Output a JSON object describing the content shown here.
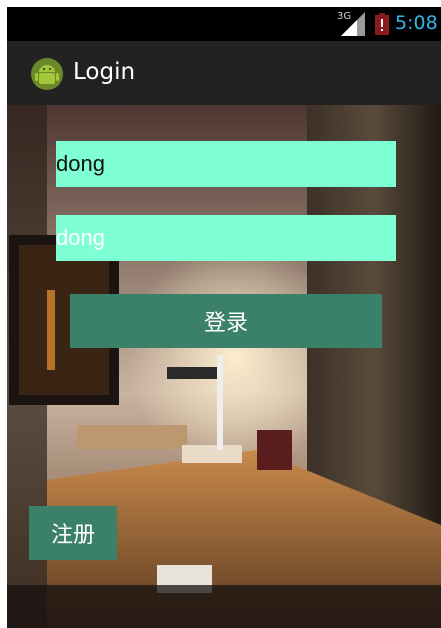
{
  "status_bar": {
    "network": "3G",
    "time": "5:08",
    "signal_icon": "signal-icon",
    "battery_icon": "battery-low-icon"
  },
  "action_bar": {
    "title": "Login",
    "app_icon": "android-icon"
  },
  "form": {
    "username_value": "dong",
    "password_value": "dong",
    "login_label": "登录",
    "register_label": "注册"
  },
  "colors": {
    "field_bg": "#7fffd4",
    "button_bg": "#3b8069",
    "clock": "#33b5e5",
    "action_bar_bg": "#222222"
  }
}
